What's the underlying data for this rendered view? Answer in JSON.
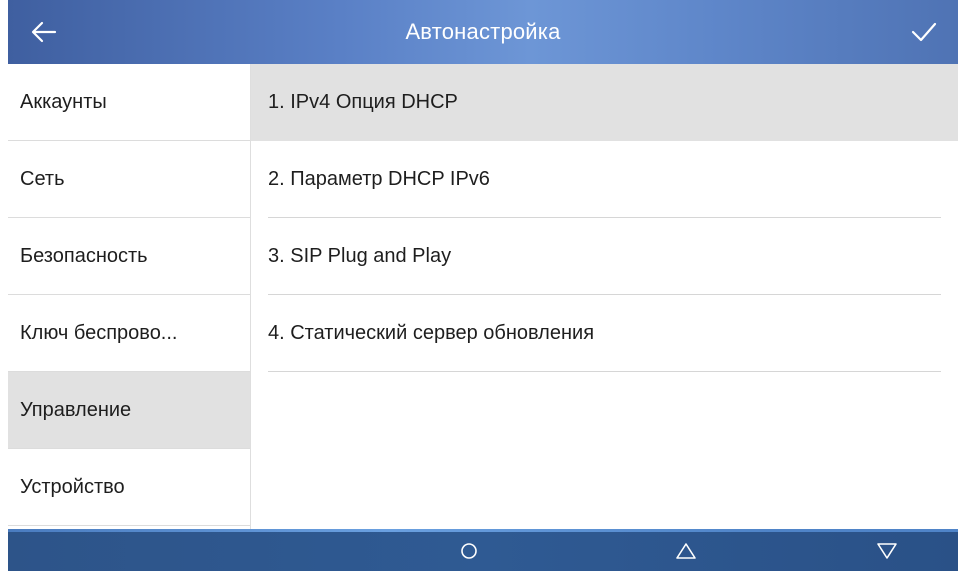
{
  "header": {
    "title": "Автонастройка",
    "back_icon": "arrow-left-icon",
    "confirm_icon": "checkmark-icon"
  },
  "sidebar": {
    "items": [
      {
        "label": "Аккаунты",
        "active": false
      },
      {
        "label": "Сеть",
        "active": false
      },
      {
        "label": "Безопасность",
        "active": false
      },
      {
        "label": "Ключ беспрово...",
        "active": false
      },
      {
        "label": "Управление",
        "active": true
      },
      {
        "label": "Устройство",
        "active": false
      }
    ]
  },
  "main": {
    "items": [
      {
        "label": "1.  IPv4 Опция DHCP",
        "active": true
      },
      {
        "label": "2.  Параметр DHCP IPv6",
        "active": false
      },
      {
        "label": "3.  SIP Plug and Play",
        "active": false
      },
      {
        "label": "4.  Статический сервер обновления",
        "active": false
      }
    ]
  },
  "navbar": {
    "home_icon": "circle-home-icon",
    "up_icon": "triangle-up-icon",
    "down_icon": "triangle-down-icon"
  },
  "colors": {
    "header": "#5a80c6",
    "navbar": "#2d5489",
    "selected": "#e1e1e1"
  }
}
